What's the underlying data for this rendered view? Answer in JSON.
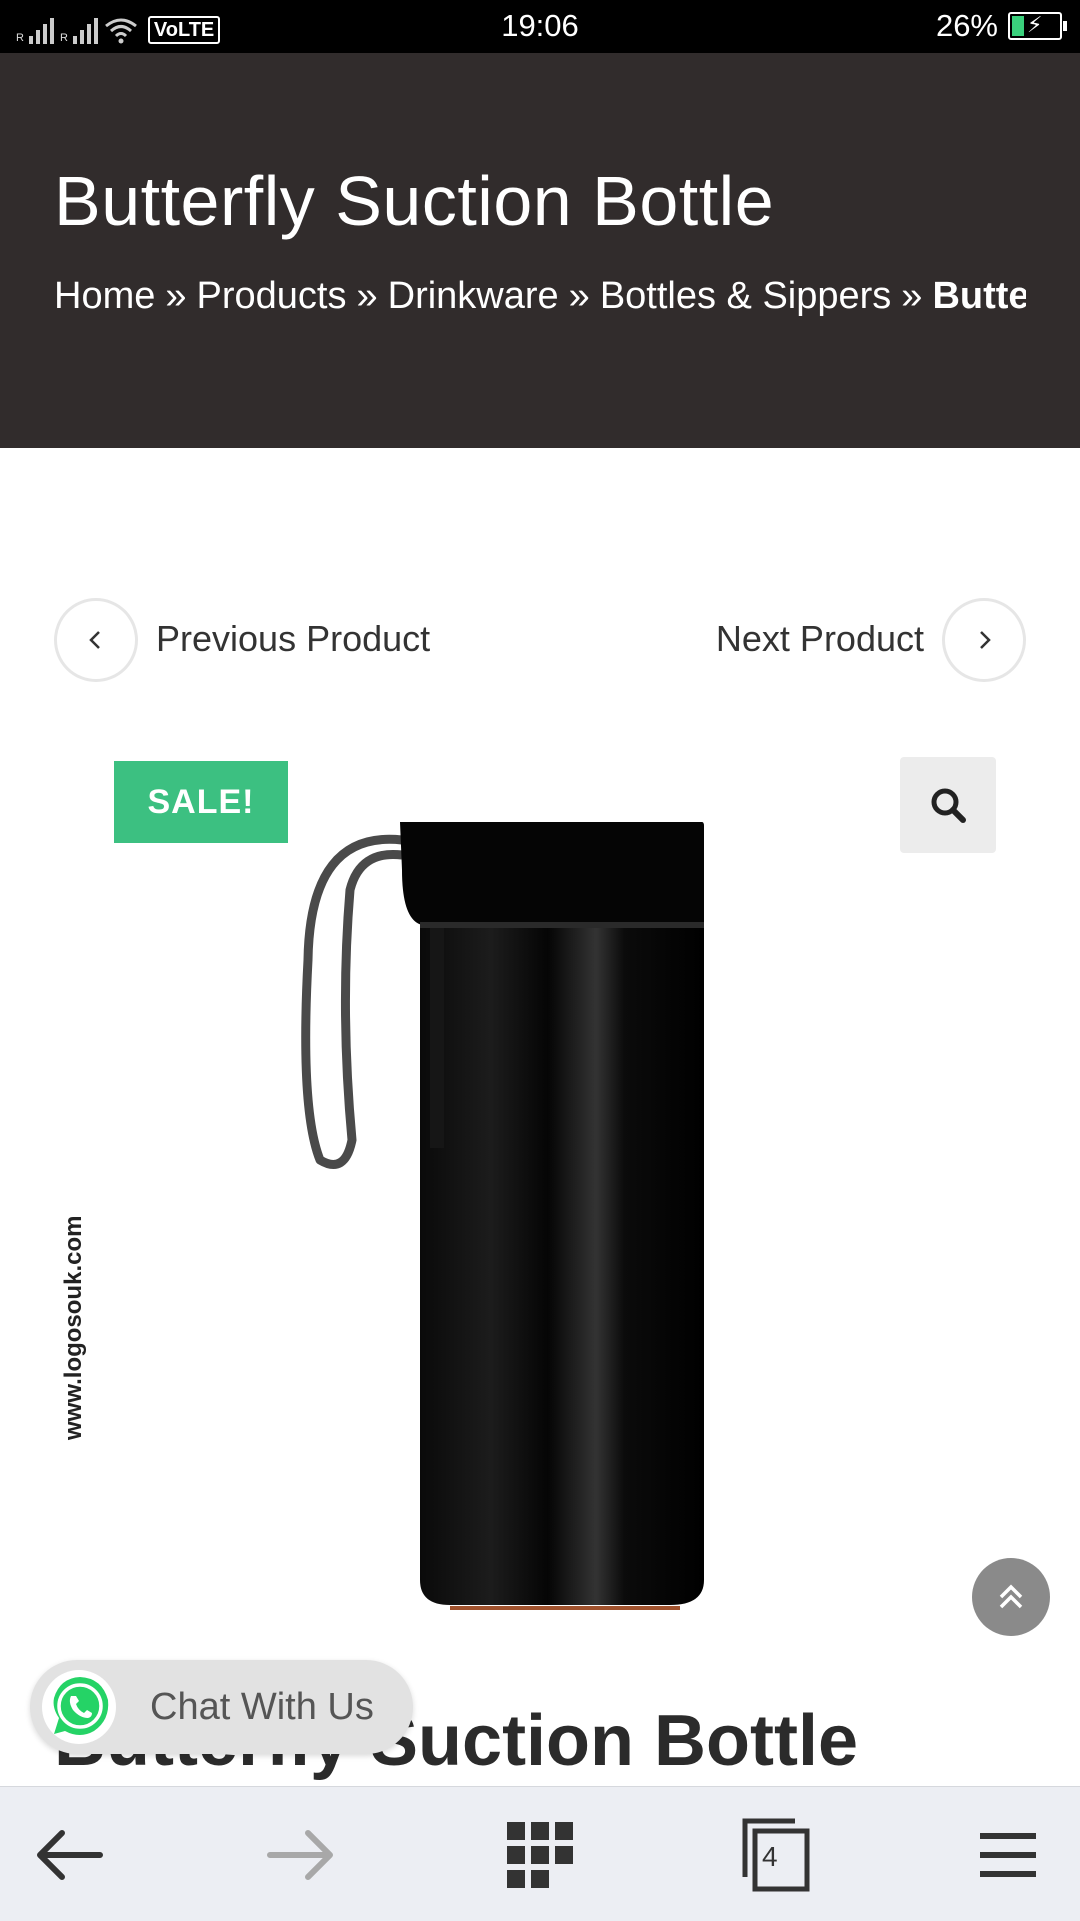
{
  "status_bar": {
    "carrier1": "R",
    "carrier2": "R",
    "network_badge": "VoLTE",
    "time": "19:06",
    "battery": "26%",
    "battery_level": 0.26
  },
  "header": {
    "title": "Butterfly Suction Bottle",
    "breadcrumb": {
      "home": "Home",
      "products": "Products",
      "category": "Drinkware",
      "subcategory": "Bottles & Sippers",
      "current": "Butterfly Suction Bottle",
      "separator": "»"
    }
  },
  "product_nav": {
    "previous": "Previous Product",
    "next": "Next Product"
  },
  "product": {
    "sale_badge": "SALE!",
    "watermark": "www.logosouk.com",
    "title": "Butterfly Suction Bottle",
    "image_icon": "black-bottle-image",
    "zoom_icon": "search-icon"
  },
  "chat": {
    "label": "Chat With Us",
    "icon": "whatsapp-icon"
  },
  "bottom_bar": {
    "back_icon": "arrow-left-icon",
    "forward_icon": "arrow-right-icon",
    "apps_icon": "grid-icon",
    "tabs_count": "4",
    "menu_icon": "hamburger-icon"
  },
  "colors": {
    "header_bg": "#312c2c",
    "sale_green": "#3cc081",
    "whatsapp_green": "#25d366"
  }
}
